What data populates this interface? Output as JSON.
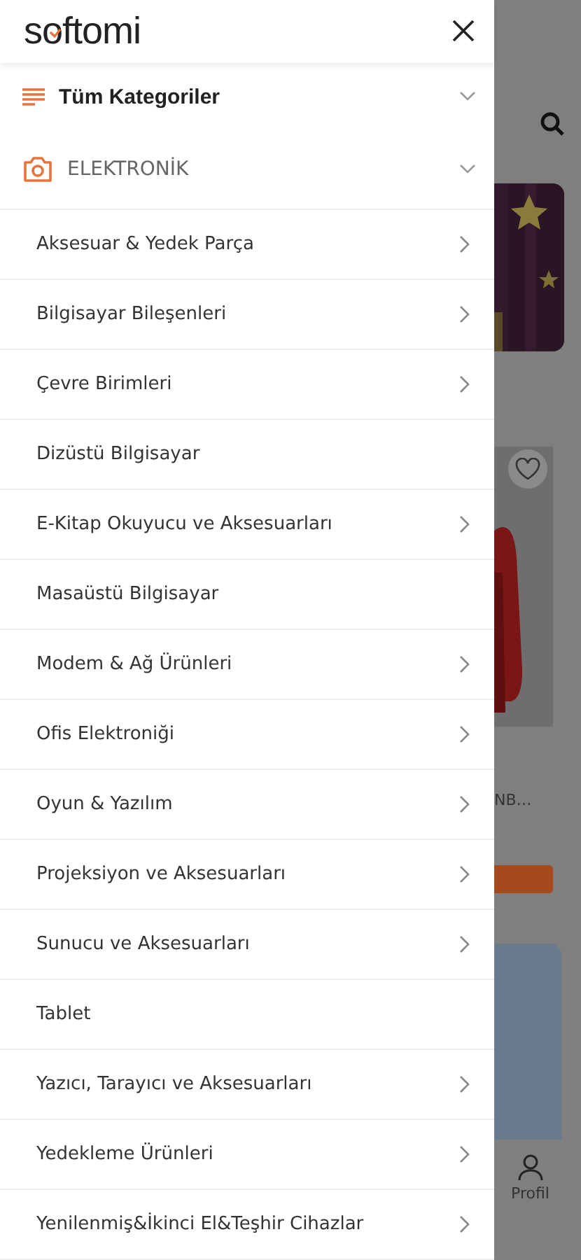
{
  "drawer": {
    "logo": "softomi",
    "sections": [
      {
        "label": "Tüm Kategoriler",
        "kind": "all"
      },
      {
        "label": "ELEKTRONİK",
        "kind": "camera"
      }
    ],
    "items": [
      {
        "label": "Aksesuar & Yedek Parça",
        "has_children": true
      },
      {
        "label": "Bilgisayar Bileşenleri",
        "has_children": true
      },
      {
        "label": "Çevre Birimleri",
        "has_children": true
      },
      {
        "label": "Dizüstü Bilgisayar",
        "has_children": false
      },
      {
        "label": "E-Kitap Okuyucu ve Aksesuarları",
        "has_children": true
      },
      {
        "label": "Masaüstü Bilgisayar",
        "has_children": false
      },
      {
        "label": "Modem & Ağ Ürünleri",
        "has_children": true
      },
      {
        "label": "Ofis Elektroniği",
        "has_children": true
      },
      {
        "label": "Oyun & Yazılım",
        "has_children": true
      },
      {
        "label": "Projeksiyon ve Aksesuarları",
        "has_children": true
      },
      {
        "label": "Sunucu ve Aksesuarları",
        "has_children": true
      },
      {
        "label": "Tablet",
        "has_children": false
      },
      {
        "label": "Yazıcı, Tarayıcı ve Aksesuarları",
        "has_children": true
      },
      {
        "label": "Yedekleme Ürünleri",
        "has_children": true
      },
      {
        "label": "Yenilenmiş&İkinci El&Teşhir Cihazlar",
        "has_children": true
      }
    ]
  },
  "background": {
    "product_title": "NB…",
    "nav_label": "Profil"
  }
}
